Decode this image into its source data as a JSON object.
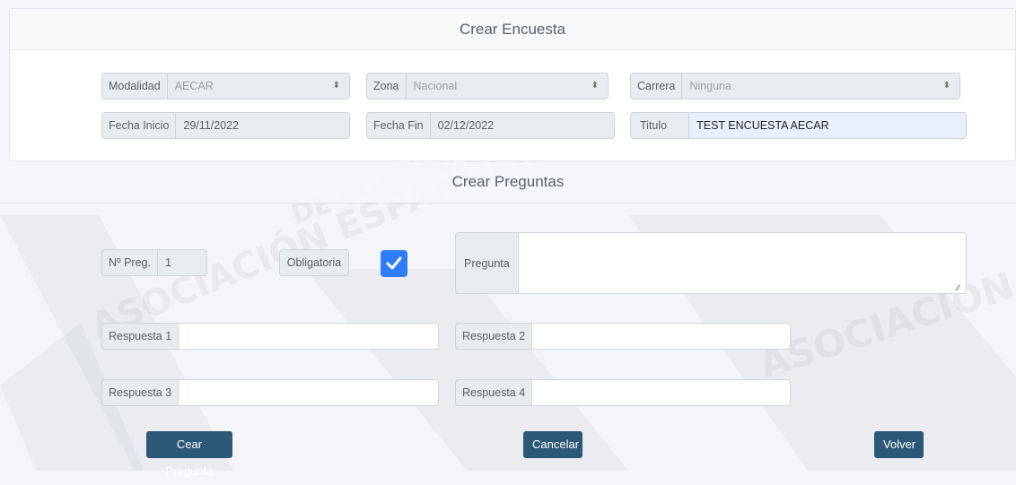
{
  "survey": {
    "title": "Crear Encuesta",
    "modalidad": {
      "label": "Modalidad",
      "value": "AECAR"
    },
    "zona": {
      "label": "Zona",
      "value": "Nacional"
    },
    "carrera": {
      "label": "Carrera",
      "value": "Ninguna"
    },
    "fecha_inicio": {
      "label": "Fecha Inicio",
      "value": "29/11/2022"
    },
    "fecha_fin": {
      "label": "Fecha Fin",
      "value": "02/12/2022"
    },
    "titulo": {
      "label": "Titulo",
      "value": "TEST ENCUESTA AECAR"
    }
  },
  "questions": {
    "title": "Crear Preguntas",
    "num_preg": {
      "label": "Nº Preg.",
      "value": "1"
    },
    "obligatoria": {
      "label": "Obligatoria",
      "checked": true
    },
    "pregunta": {
      "label": "Pregunta",
      "value": ""
    },
    "respuesta1": {
      "label": "Respuesta 1",
      "value": ""
    },
    "respuesta2": {
      "label": "Respuesta 2",
      "value": ""
    },
    "respuesta3": {
      "label": "Respuesta 3",
      "value": ""
    },
    "respuesta4": {
      "label": "Respuesta 4",
      "value": ""
    }
  },
  "buttons": {
    "create": "Cear Pregunta",
    "cancel": "Cancelar",
    "back": "Volver"
  },
  "watermark": {
    "text1": "ASOCIACIÓN ESPAÑOLA",
    "text2": "DE COCHES A RADIO",
    "text3": "ASOCIACIÓN ESPAÑOLA"
  },
  "colors": {
    "button": "#2d5978",
    "checkbox": "#2f7df6",
    "autofill": "#e8f0fe"
  }
}
